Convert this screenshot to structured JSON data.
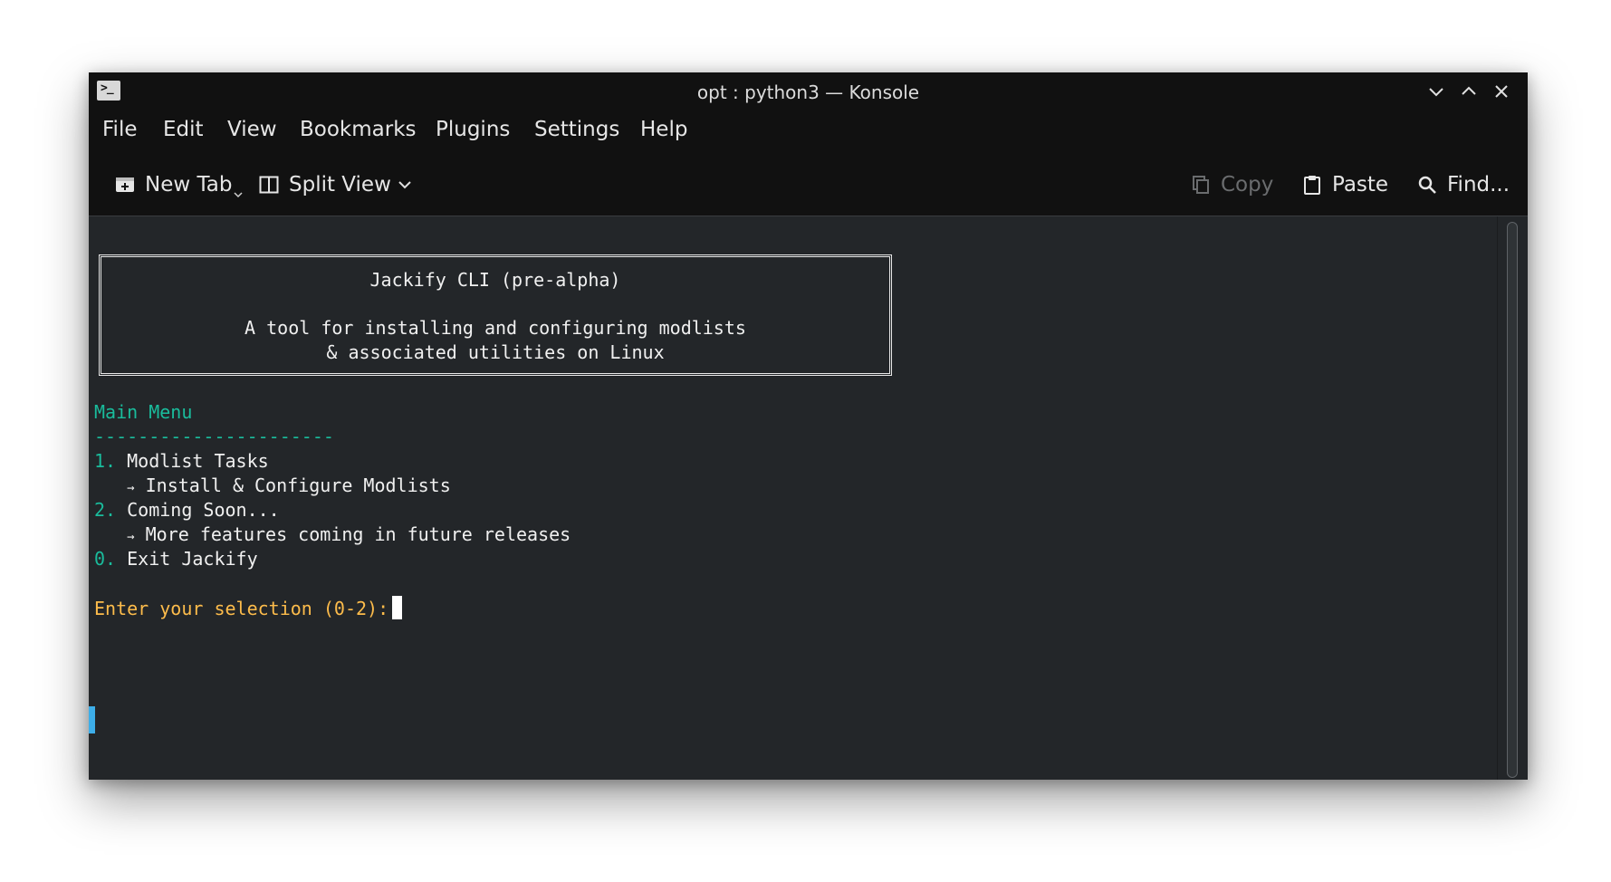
{
  "window": {
    "title": "opt : python3 — Konsole"
  },
  "menubar": {
    "items": [
      "File",
      "Edit",
      "View",
      "Bookmarks",
      "Plugins",
      "Settings",
      "Help"
    ]
  },
  "toolbar": {
    "new_tab": "New Tab",
    "split_view": "Split View",
    "copy": "Copy",
    "paste": "Paste",
    "find": "Find..."
  },
  "terminal": {
    "banner": {
      "title": "Jackify CLI (pre-alpha)",
      "line1": "A tool for installing and configuring modlists",
      "line2": "& associated utilities on Linux"
    },
    "menu_heading": "Main Menu",
    "separator": "----------------------",
    "options": [
      {
        "num": "1.",
        "label": "Modlist Tasks",
        "arrow": "→",
        "detail": "Install & Configure Modlists"
      },
      {
        "num": "2.",
        "label": "Coming Soon...",
        "arrow": "→",
        "detail": "More features coming in future releases"
      },
      {
        "num": "0.",
        "label": "Exit Jackify"
      }
    ],
    "prompt": "Enter your selection (0-2):"
  },
  "colors": {
    "terminal_bg": "#232629",
    "chrome_bg": "#111111",
    "accent_green": "#1abc9c",
    "prompt_yellow": "#fdbc4b",
    "selection_marker": "#3daee9"
  },
  "icons": {
    "app": "terminal-prompt-icon",
    "minimize": "chevron-down-icon",
    "maximize": "chevron-up-icon",
    "close": "close-icon",
    "new_tab": "new-tab-icon",
    "split_view": "split-view-icon",
    "split_dropdown": "chevron-down-icon",
    "copy": "copy-icon",
    "paste": "paste-icon",
    "find": "search-icon"
  }
}
